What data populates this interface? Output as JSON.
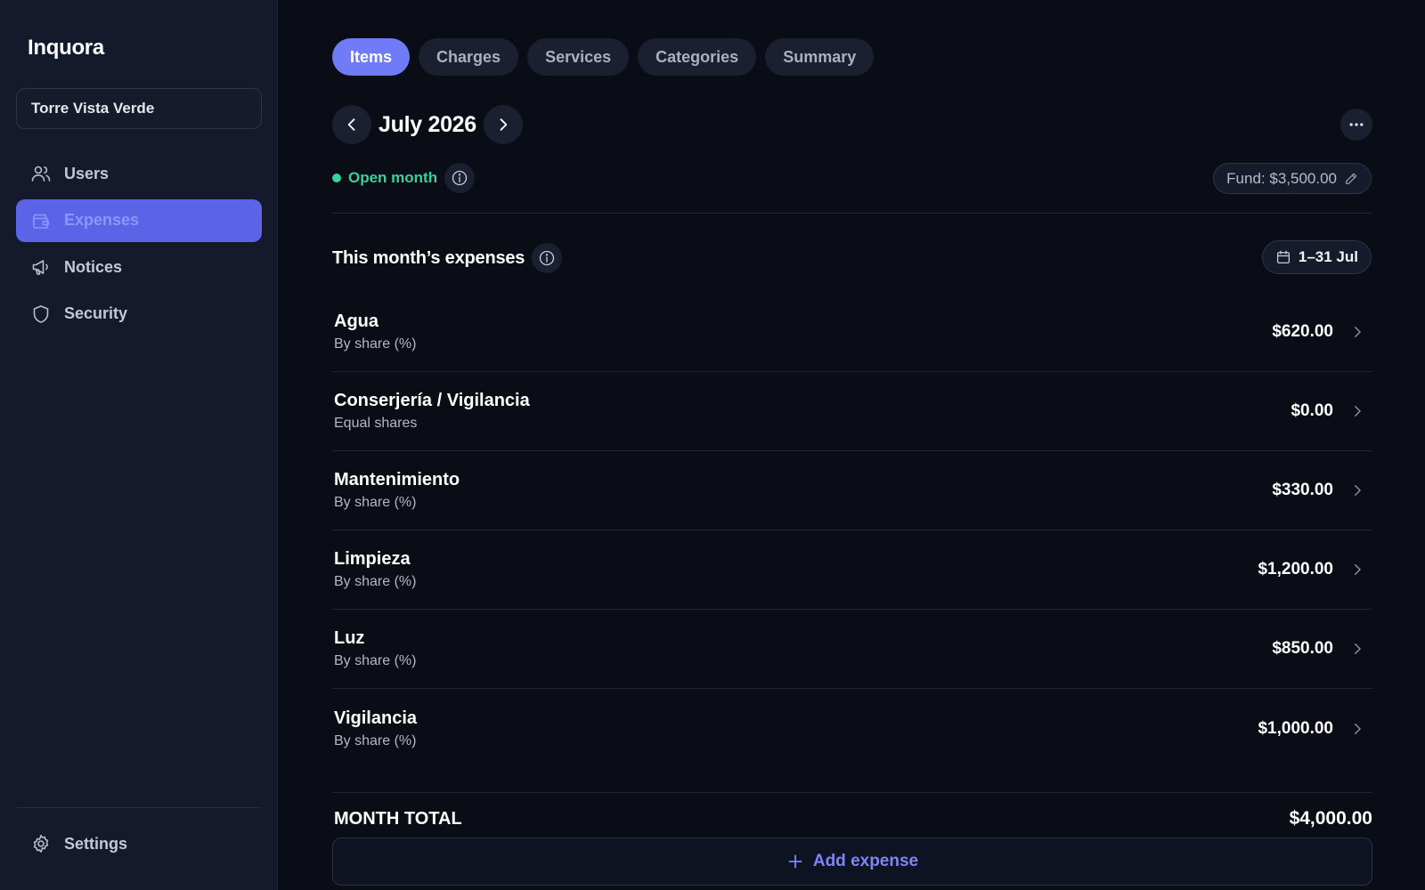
{
  "app": {
    "brand": "Inquora"
  },
  "building": {
    "name": "Torre Vista Verde"
  },
  "sidebar": {
    "items": [
      {
        "label": "Users",
        "icon": "users-icon"
      },
      {
        "label": "Expenses",
        "icon": "wallet-icon",
        "active": true
      },
      {
        "label": "Notices",
        "icon": "megaphone-icon"
      },
      {
        "label": "Security",
        "icon": "shield-icon"
      }
    ],
    "settings_label": "Settings"
  },
  "tabs": [
    {
      "label": "Items",
      "active": true
    },
    {
      "label": "Charges"
    },
    {
      "label": "Services"
    },
    {
      "label": "Categories"
    },
    {
      "label": "Summary"
    }
  ],
  "period": {
    "title": "July 2026",
    "status": "Open month",
    "fund": "Fund: $3,500.00",
    "range": "1–31 Jul"
  },
  "section": {
    "title": "This month’s expenses"
  },
  "expenses": [
    {
      "name": "Agua",
      "method": "By share (%)",
      "amount": "$620.00"
    },
    {
      "name": "Conserjería / Vigilancia",
      "method": "Equal shares",
      "amount": "$0.00"
    },
    {
      "name": "Mantenimiento",
      "method": "By share (%)",
      "amount": "$330.00"
    },
    {
      "name": "Limpieza",
      "method": "By share (%)",
      "amount": "$1,200.00"
    },
    {
      "name": "Luz",
      "method": "By share (%)",
      "amount": "$850.00"
    },
    {
      "name": "Vigilancia",
      "method": "By share (%)",
      "amount": "$1,000.00"
    }
  ],
  "totals": {
    "label": "MONTH TOTAL",
    "value": "$4,000.00"
  },
  "actions": {
    "add_expense": "Add expense"
  },
  "colors": {
    "accent": "#6f7bf7",
    "sidebar_active": "#5b63e6",
    "status_open": "#34d399",
    "background": "#0a0d15",
    "sidebar_bg": "#141a2b"
  }
}
